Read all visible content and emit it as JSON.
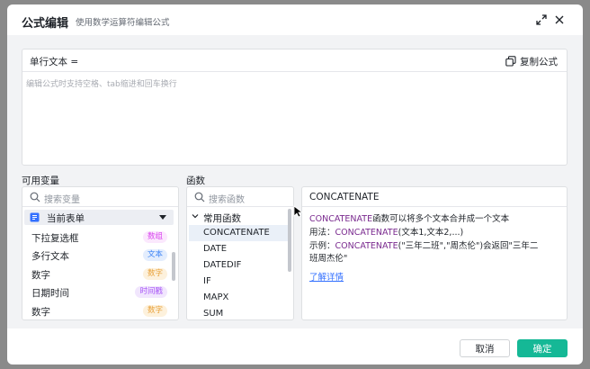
{
  "dialog": {
    "title": "公式编辑",
    "subtitle": "使用数学运算符编辑公式",
    "icons": [
      "expand-icon",
      "close-icon"
    ]
  },
  "editor": {
    "label": "单行文本 =",
    "copy_label": "复制公式",
    "placeholder": "编辑公式时支持空格、tab缩进和回车换行"
  },
  "variables": {
    "section_label": "可用变量",
    "search_placeholder": "搜索变量",
    "group_label": "当前表单",
    "items": [
      {
        "label": "下拉复选框",
        "tag": "数组",
        "tag_color": "#d946ef",
        "tag_bg": "#fbe8fd"
      },
      {
        "label": "多行文本",
        "tag": "文本",
        "tag_color": "#3b82f6",
        "tag_bg": "#e3edfd"
      },
      {
        "label": "数字",
        "tag": "数字",
        "tag_color": "#e8a13a",
        "tag_bg": "#fdf1dc"
      },
      {
        "label": "日期时间",
        "tag": "时间戳",
        "tag_color": "#a855f7",
        "tag_bg": "#f1e6fd"
      },
      {
        "label": "数字",
        "tag": "数字",
        "tag_color": "#e8a13a",
        "tag_bg": "#fdf1dc"
      }
    ]
  },
  "functions": {
    "section_label": "函数",
    "search_placeholder": "搜索函数",
    "group_label": "常用函数",
    "items": [
      "CONCATENATE",
      "DATE",
      "DATEDIF",
      "IF",
      "MAPX",
      "SUM"
    ],
    "selected": "CONCATENATE"
  },
  "detail": {
    "title": "CONCATENATE",
    "line1_fn": "CONCATENATE",
    "line1_text": "函数可以将多个文本合并成一个文本",
    "line2_prefix": "用法：",
    "line2_fn": "CONCATENATE",
    "line2_text": "(文本1,文本2,...)",
    "line3_prefix": "示例：",
    "line3_fn": "CONCATENATE",
    "line3_text": "(\"三年二班\",\"周杰伦\")会返回\"三年二",
    "line4_text": "班周杰伦\"",
    "more_link": "了解详情"
  },
  "footer": {
    "cancel_label": "取消",
    "ok_label": "确定"
  },
  "colors": {
    "accent": "#15b896",
    "function_text": "#7a2a8f",
    "link": "#3370ff"
  }
}
